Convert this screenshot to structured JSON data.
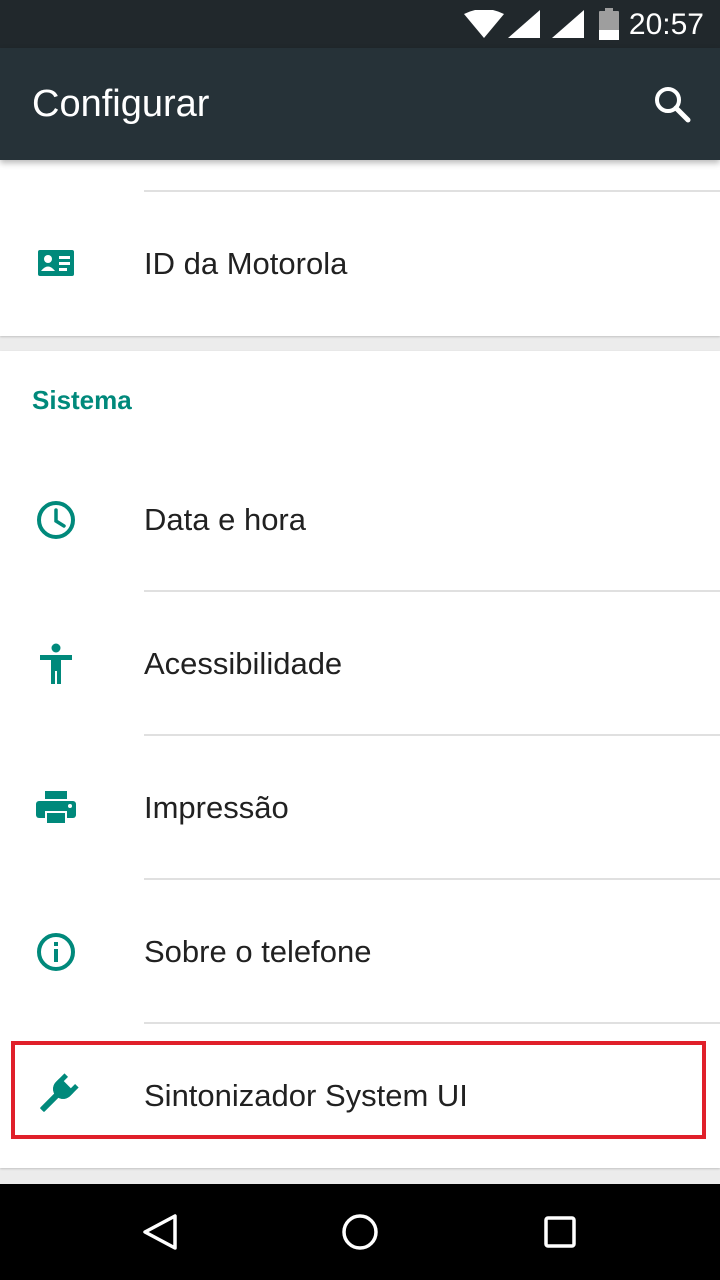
{
  "status_bar": {
    "time": "20:57",
    "icons": [
      "wifi-icon",
      "signal-icon",
      "signal-icon",
      "battery-icon"
    ]
  },
  "app_bar": {
    "title": "Configurar",
    "action_icon": "search-icon"
  },
  "top_card": {
    "items": [
      {
        "label": "ID da Motorola",
        "icon": "account-card-icon"
      }
    ]
  },
  "sistema": {
    "header": "Sistema",
    "items": [
      {
        "label": "Data e hora",
        "icon": "clock-icon"
      },
      {
        "label": "Acessibilidade",
        "icon": "accessibility-icon"
      },
      {
        "label": "Impressão",
        "icon": "print-icon"
      },
      {
        "label": "Sobre o telefone",
        "icon": "info-icon"
      },
      {
        "label": "Sintonizador System UI",
        "icon": "wrench-icon",
        "highlighted": true
      }
    ]
  },
  "colors": {
    "accent": "#00897b",
    "app_bar": "#263238",
    "status_bar": "#21282c",
    "highlight": "#e0202a"
  },
  "nav_bar": {
    "buttons": [
      "back-icon",
      "home-icon",
      "recents-icon"
    ]
  }
}
